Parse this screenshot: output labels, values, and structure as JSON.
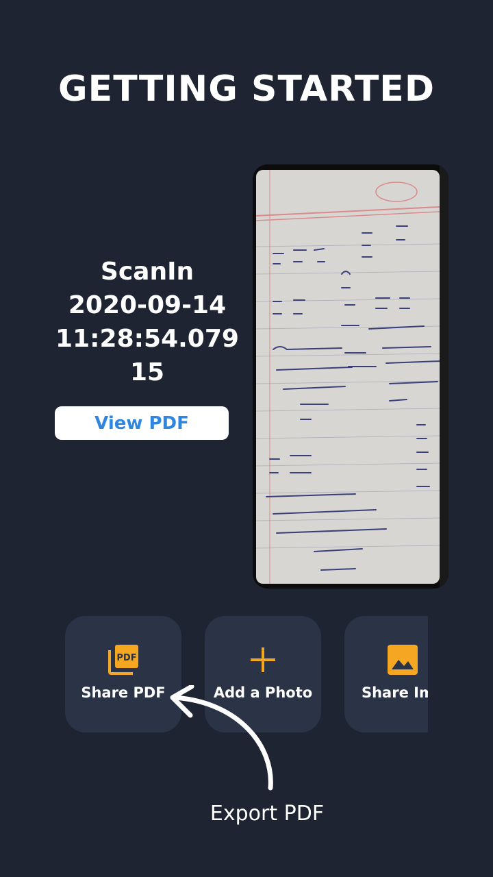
{
  "header": {
    "title": "GETTING STARTED"
  },
  "document": {
    "app_name": "ScanIn",
    "date": "2020-09-14",
    "time": "11:28:54.07915",
    "view_button": "View PDF"
  },
  "actions": [
    {
      "label": "Share PDF",
      "icon": "pdf-icon"
    },
    {
      "label": "Add a Photo",
      "icon": "plus-icon"
    },
    {
      "label": "Share Ima",
      "icon": "image-icon"
    }
  ],
  "annotation": {
    "text": "Export PDF"
  },
  "colors": {
    "background": "#1f2432",
    "card": "#2b3346",
    "accent_orange": "#f5a623",
    "link_blue": "#2f86e0"
  }
}
